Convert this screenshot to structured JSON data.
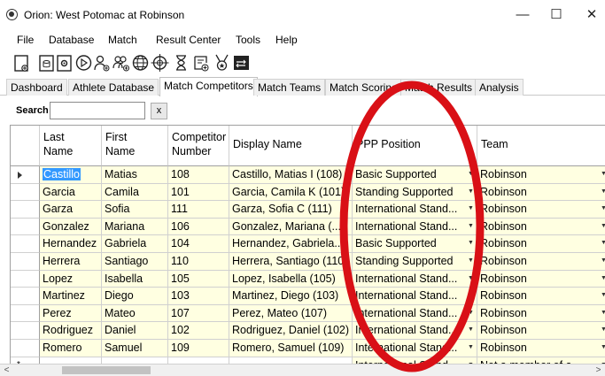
{
  "window": {
    "title": "Orion: West Potomac at Robinson",
    "minimize": "—",
    "maximize": "☐",
    "close": "✕"
  },
  "menu": [
    "File",
    "Database",
    "Match",
    "Result Center",
    "Tools",
    "Help"
  ],
  "toolbar_icons": [
    "new-document-icon",
    "open-database-icon",
    "settings-icon",
    "play-icon",
    "add-athlete-icon",
    "add-team-icon",
    "globe-icon",
    "target-icon",
    "hourglass-icon",
    "add-result-icon",
    "award-icon",
    "terminal-icon"
  ],
  "tabs": [
    "Dashboard",
    "Athlete Database",
    "Match Competitors",
    "Match Teams",
    "Match Scoring",
    "Match Results",
    "Analysis"
  ],
  "active_tab": "Match Competitors",
  "search": {
    "label": "Search",
    "value": "",
    "clear_label": "x"
  },
  "grid": {
    "columns": [
      [
        "Last",
        "Name"
      ],
      [
        "First",
        "Name"
      ],
      [
        "Competitor",
        "Number"
      ],
      [
        "Display Name"
      ],
      [
        "PPP Position"
      ],
      [
        "Team"
      ]
    ],
    "rows": [
      [
        "Castillo",
        "Matias",
        "108",
        "Castillo, Matias I (108)",
        "Basic Supported",
        "Robinson"
      ],
      [
        "Garcia",
        "Camila",
        "101",
        "Garcia, Camila K (101)",
        "Standing Supported",
        "Robinson"
      ],
      [
        "Garza",
        "Sofia",
        "111",
        "Garza, Sofia C (111)",
        "International Stand...",
        "Robinson"
      ],
      [
        "Gonzalez",
        "Mariana",
        "106",
        "Gonzalez, Mariana (...",
        "International Stand...",
        "Robinson"
      ],
      [
        "Hernandez",
        "Gabriela",
        "104",
        "Hernandez, Gabriela...",
        "Basic Supported",
        "Robinson"
      ],
      [
        "Herrera",
        "Santiago",
        "110",
        "Herrera, Santiago (110)",
        "Standing Supported",
        "Robinson"
      ],
      [
        "Lopez",
        "Isabella",
        "105",
        "Lopez, Isabella (105)",
        "International Stand...",
        "Robinson"
      ],
      [
        "Martinez",
        "Diego",
        "103",
        "Martinez, Diego (103)",
        "International Stand...",
        "Robinson"
      ],
      [
        "Perez",
        "Mateo",
        "107",
        "Perez, Mateo (107)",
        "International Stand...",
        "Robinson"
      ],
      [
        "Rodriguez",
        "Daniel",
        "102",
        "Rodriguez, Daniel (102)",
        "International Stand...",
        "Robinson"
      ],
      [
        "Romero",
        "Samuel",
        "109",
        "Romero, Samuel (109)",
        "International Stand...",
        "Robinson"
      ]
    ],
    "new_row": [
      "",
      "",
      "",
      "",
      "International Stand...",
      "Not a member of a..."
    ],
    "new_row_marker": "*",
    "dropdown_glyph": "▼",
    "colors": {
      "cell_bg": "#ffffe1",
      "selection": "#3399ff",
      "annotation": "#d91016"
    }
  },
  "scrollbar": {
    "left": "<",
    "right": ">"
  }
}
